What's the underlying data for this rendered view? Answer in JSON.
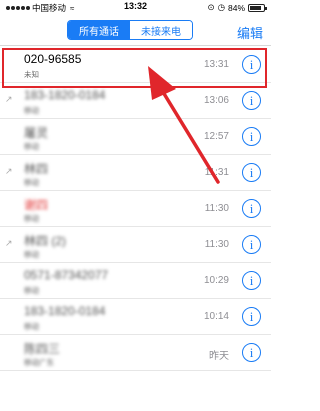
{
  "status_bar": {
    "carrier": "中国移动",
    "time": "13:32",
    "battery_text": "84%",
    "battery_level": 0.84
  },
  "nav": {
    "segments": [
      {
        "label": "所有通话",
        "active": true
      },
      {
        "label": "未接来电",
        "active": false
      }
    ],
    "edit_label": "编辑"
  },
  "calls": [
    {
      "name": "020-96585",
      "sub": "未知",
      "time": "13:31",
      "blurred": false,
      "outgoing": false,
      "missed": false
    },
    {
      "name": "183-1820-0184",
      "sub": "移动",
      "time": "13:06",
      "blurred": true,
      "outgoing": true,
      "missed": false
    },
    {
      "name": "屠灵",
      "sub": "移动",
      "time": "12:57",
      "blurred": true,
      "outgoing": false,
      "missed": false
    },
    {
      "name": "林四",
      "sub": "移动",
      "time": "11:31",
      "blurred": true,
      "outgoing": true,
      "missed": false
    },
    {
      "name": "谢四",
      "sub": "移动",
      "time": "11:30",
      "blurred": true,
      "outgoing": false,
      "missed": true
    },
    {
      "name": "林四 (2)",
      "sub": "移动",
      "time": "11:30",
      "blurred": true,
      "outgoing": true,
      "missed": false
    },
    {
      "name": "0571-87342077",
      "sub": "移动",
      "time": "10:29",
      "blurred": true,
      "outgoing": false,
      "missed": false
    },
    {
      "name": "183-1820-0184",
      "sub": "移动",
      "time": "10:14",
      "blurred": true,
      "outgoing": false,
      "missed": false
    },
    {
      "name": "陈四三",
      "sub": "移动广东",
      "time": "昨天",
      "blurred": true,
      "outgoing": false,
      "missed": false
    }
  ],
  "info_glyph": "i",
  "colors": {
    "accent": "#1a7cf5",
    "annotation": "#e0262b",
    "missed": "#e23b3b"
  }
}
